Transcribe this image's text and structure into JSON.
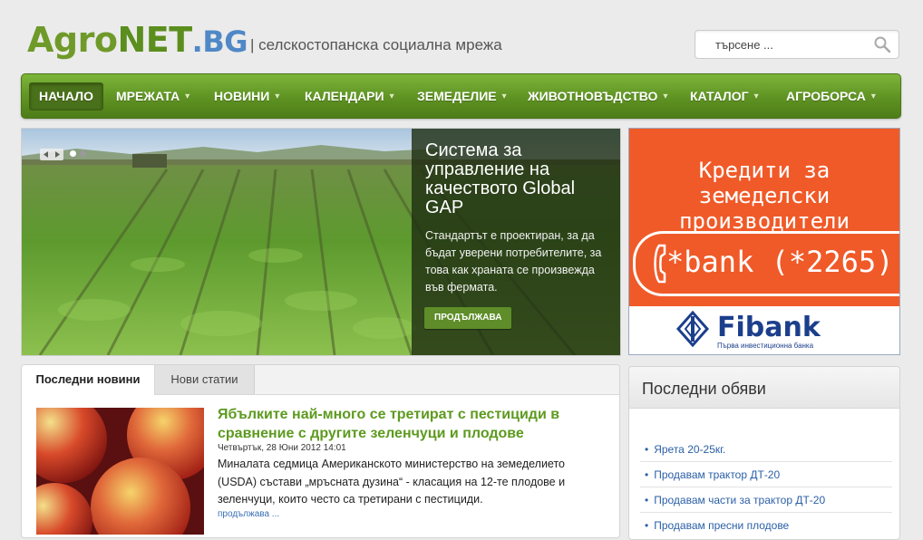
{
  "header": {
    "logo_agro": "Agro",
    "logo_net": "NET",
    "logo_bg": ".BG",
    "tagline": "| селскостопанска социална мрежа",
    "search_placeholder": "търсене ..."
  },
  "nav": {
    "items": [
      {
        "label": "НАЧАЛО",
        "active": true,
        "dropdown": false
      },
      {
        "label": "МРЕЖАТА",
        "dropdown": true
      },
      {
        "label": "НОВИНИ",
        "dropdown": true
      },
      {
        "label": "КАЛЕНДАРИ",
        "dropdown": true
      },
      {
        "label": "ЗЕМЕДЕЛИЕ",
        "dropdown": true
      },
      {
        "label": "ЖИВОТНОВЪДСТВО",
        "dropdown": true
      },
      {
        "label": "КАТАЛОГ",
        "dropdown": true
      },
      {
        "label": "АГРОБОРСА",
        "dropdown": true
      }
    ]
  },
  "slider": {
    "title": "Система за управление на качеството Global GAP",
    "text": "Стандартът е проектиран, за да бъдат уверени потребителите, за това как храната се произвежда във фермата.",
    "button": "ПРОДЪЛЖАВА"
  },
  "ad": {
    "headline_1": "Кредити за земеделски",
    "headline_2": "производители",
    "phone": "*bank (*2265)",
    "brand": "Fibank",
    "brand_sub": "Първа инвестиционна банка"
  },
  "news": {
    "tabs": [
      "Последни новини",
      "Нови статии"
    ],
    "title": "Ябълките най-много се третират с пестициди в сравнение с другите зеленчуци и плодове",
    "date": "Четвъртък, 28 Юни 2012 14:01",
    "text": "Миналата седмица Американското министерство на земеделието (USDA) състави „мръсната дузина“ - класация на 12-те плодове и зеленчуци, които често са третирани с пестициди.",
    "more": "продължава ..."
  },
  "classifieds": {
    "title": "Последни обяви",
    "items": [
      "Ярета 20-25кг.",
      "Продавам трактор ДТ-20",
      "Продавам части за трактор ДТ-20",
      "Продавам пресни плодове"
    ]
  },
  "colors": {
    "nav_green": "#5e9222",
    "ad_orange": "#f05a28",
    "link_blue": "#2b5fa6",
    "title_green": "#5d9a1f"
  }
}
